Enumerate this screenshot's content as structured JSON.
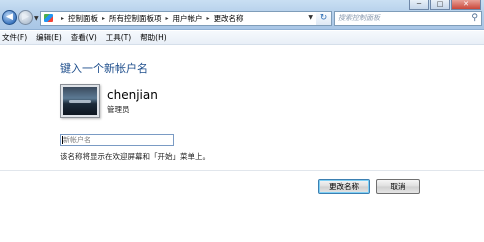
{
  "window": {
    "minimize_glyph": "─",
    "maximize_glyph": "□",
    "close_glyph": "✕"
  },
  "navigation": {
    "back_glyph": "◀",
    "forward_glyph": "▶",
    "dropdown_glyph": "▼",
    "refresh_glyph": "↻",
    "breadcrumb": [
      "控制面板",
      "所有控制面板项",
      "用户帐户",
      "更改名称"
    ],
    "breadcrumb_separator": "▸"
  },
  "search": {
    "placeholder": "搜索控制面板",
    "icon": "search-icon"
  },
  "menu": {
    "items": [
      "文件(F)",
      "编辑(E)",
      "查看(V)",
      "工具(T)",
      "帮助(H)"
    ]
  },
  "main": {
    "title": "键入一个新帐户名",
    "user": {
      "name": "chenjian",
      "role": "管理员"
    },
    "input": {
      "value": "",
      "placeholder": "新帐户名"
    },
    "hint": "该名称将显示在欢迎屏幕和「开始」菜单上。"
  },
  "buttons": {
    "confirm_label": "更改名称",
    "cancel_label": "取消"
  },
  "colors": {
    "title_blue": "#1e4e8c",
    "chrome_blue": "#b2cde9",
    "primary_focus": "#3c7fb1"
  }
}
